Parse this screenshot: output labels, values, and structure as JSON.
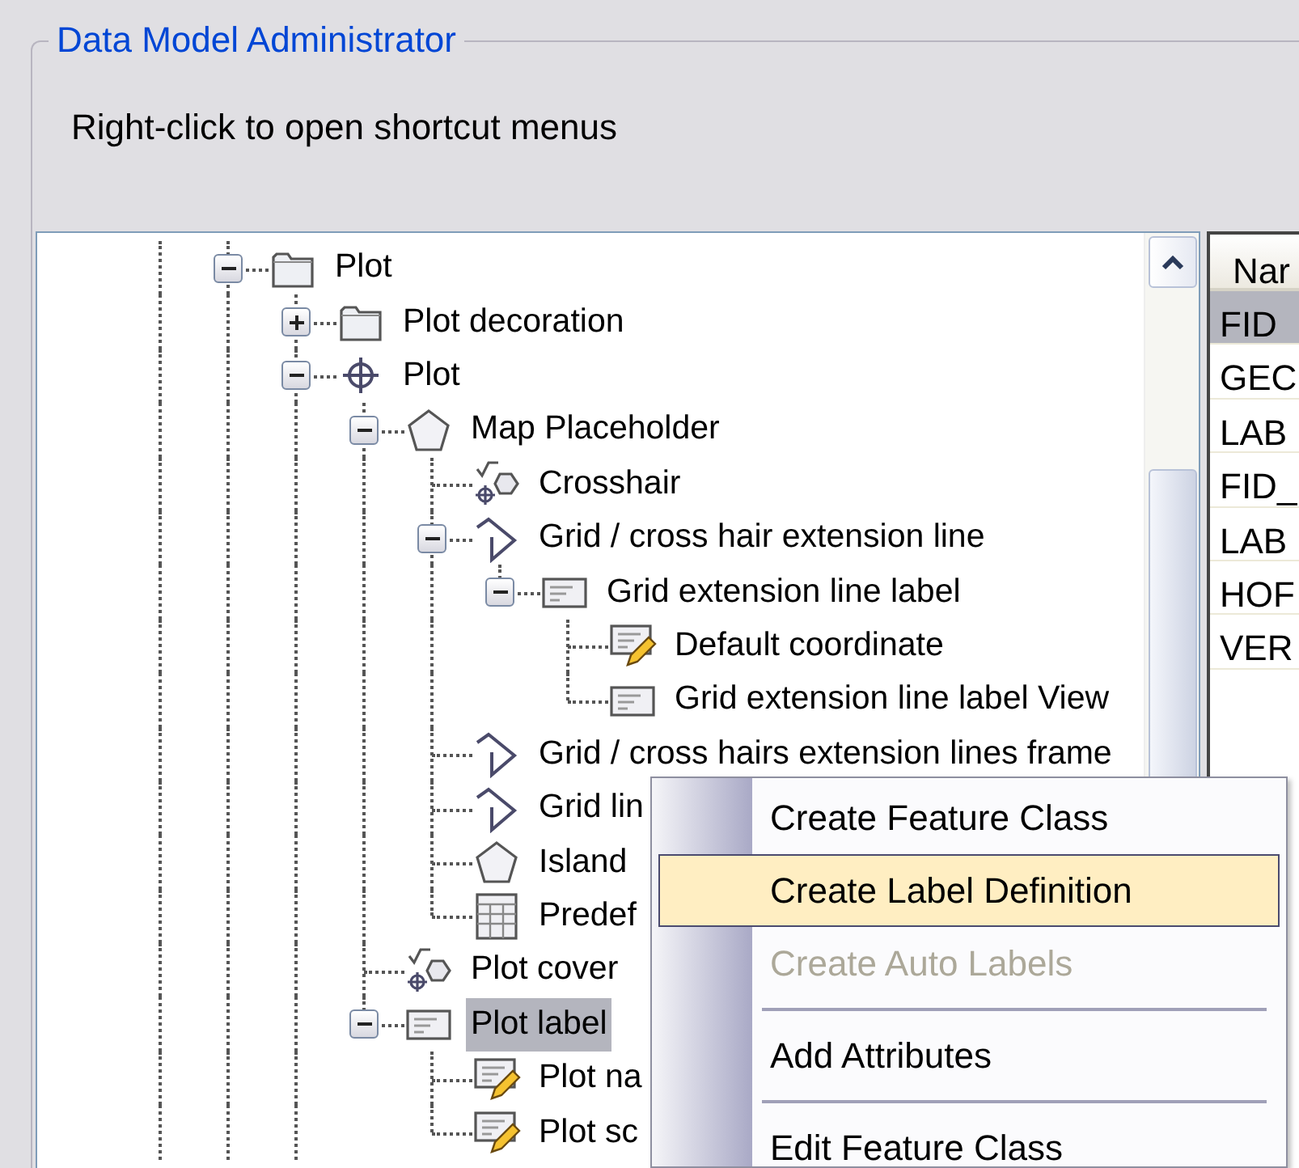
{
  "group": {
    "title": "Data Model Administrator",
    "hint": "Right-click to open shortcut menus"
  },
  "tree": [
    {
      "label": "Plot",
      "kind": "folder",
      "expanded": true,
      "selected": false,
      "more_below": true,
      "children": [
        {
          "label": "Plot decoration",
          "kind": "folder",
          "expanded": false,
          "selected": false
        },
        {
          "label": "Plot",
          "kind": "crosshair",
          "expanded": true,
          "selected": false,
          "more_below": true,
          "children": [
            {
              "label": "Map Placeholder",
              "kind": "pentagon",
              "expanded": true,
              "selected": false,
              "children": [
                {
                  "label": "Crosshair",
                  "kind": "symbol",
                  "selected": false
                },
                {
                  "label": "Grid / cross hair extension line",
                  "kind": "line",
                  "expanded": true,
                  "selected": false,
                  "children": [
                    {
                      "label": "Grid extension line label",
                      "kind": "label",
                      "expanded": true,
                      "selected": false,
                      "children": [
                        {
                          "label": "Default coordinate",
                          "kind": "labeledit",
                          "selected": false
                        },
                        {
                          "label": "Grid extension line label View",
                          "kind": "label",
                          "selected": false
                        }
                      ]
                    }
                  ]
                },
                {
                  "label": "Grid / cross hairs extension lines frame",
                  "kind": "line",
                  "selected": false
                },
                {
                  "label": "Grid lin",
                  "kind": "line",
                  "selected": false
                },
                {
                  "label": "Island",
                  "kind": "pentagon",
                  "selected": false
                },
                {
                  "label": "Predef",
                  "kind": "table",
                  "selected": false
                }
              ]
            },
            {
              "label": "Plot cover",
              "kind": "symbol",
              "selected": false
            },
            {
              "label": "Plot label",
              "kind": "label",
              "expanded": true,
              "selected": true,
              "children": [
                {
                  "label": "Plot na",
                  "kind": "labeledit",
                  "selected": false
                },
                {
                  "label": "Plot sc",
                  "kind": "labeledit",
                  "selected": false
                }
              ]
            }
          ]
        }
      ]
    }
  ],
  "list": {
    "header": "Nar",
    "rows": [
      {
        "text": "FID",
        "selected": true
      },
      {
        "text": "GEC",
        "selected": false
      },
      {
        "text": "LAB",
        "selected": false
      },
      {
        "text": "FID_",
        "selected": false
      },
      {
        "text": "LAB",
        "selected": false
      },
      {
        "text": "HOF",
        "selected": false
      },
      {
        "text": "VER",
        "selected": false
      }
    ]
  },
  "context_menu": [
    {
      "kind": "item",
      "label": "Create Feature Class",
      "disabled": false,
      "selected": false
    },
    {
      "kind": "item",
      "label": "Create Label Definition",
      "disabled": false,
      "selected": true
    },
    {
      "kind": "item",
      "label": "Create Auto Labels",
      "disabled": true,
      "selected": false
    },
    {
      "kind": "separator"
    },
    {
      "kind": "item",
      "label": "Add Attributes",
      "disabled": false,
      "selected": false
    },
    {
      "kind": "separator"
    },
    {
      "kind": "item",
      "label": "Edit Feature Class",
      "disabled": false,
      "selected": false
    }
  ]
}
